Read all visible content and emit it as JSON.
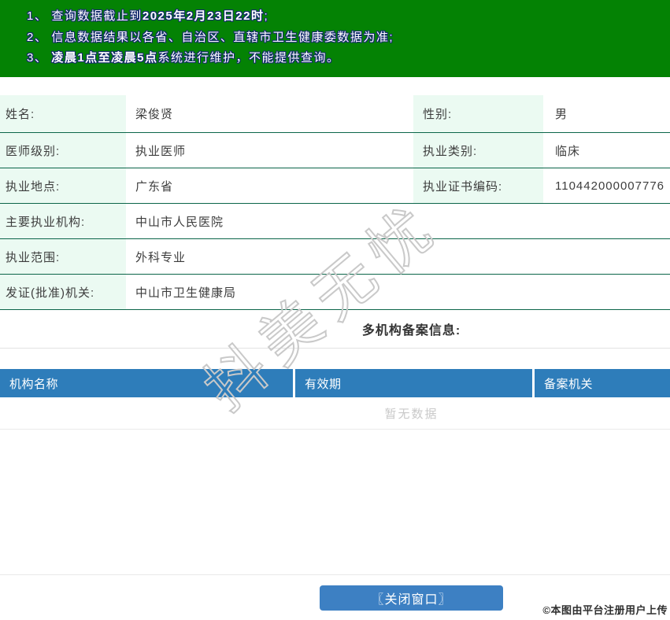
{
  "banner": {
    "notices": [
      {
        "num": "1、",
        "pre": "查询数据截止到",
        "bold": "2025年2月23日22时",
        "post": ";"
      },
      {
        "num": "2、",
        "pre": "信息数据结果以各省、自治区、直辖市卫生健康委数据为准;",
        "bold": "",
        "post": ""
      },
      {
        "num": "3、",
        "pre": "",
        "bold": "凌晨1点至凌晨5点",
        "post": "系统进行维护，不能提供查询。"
      }
    ]
  },
  "info": {
    "rows2col": [
      {
        "label1": "姓名:",
        "value1": "梁俊贤",
        "label2": "性别:",
        "value2": "男"
      },
      {
        "label1": "医师级别:",
        "value1": "执业医师",
        "label2": "执业类别:",
        "value2": "临床"
      },
      {
        "label1": "执业地点:",
        "value1": "广东省",
        "label2": "执业证书编码:",
        "value2": "110442000007776"
      }
    ],
    "rows1col": [
      {
        "label": "主要执业机构:",
        "value": "中山市人民医院"
      },
      {
        "label": "执业范围:",
        "value": "外科专业"
      },
      {
        "label": "发证(批准)机关:",
        "value": "中山市卫生健康局"
      }
    ]
  },
  "filing": {
    "title": "多机构备案信息:",
    "columns": [
      "机构名称",
      "有效期",
      "备案机关"
    ],
    "empty_text": "暂无数据"
  },
  "watermark_text": "抖美无忧",
  "footer": {
    "close_button": "〖关闭窗口〗",
    "copyright": "©本图由平台注册用户上传"
  },
  "colors": {
    "banner_green": "#048204",
    "banner_text_outline": "#142a6e",
    "label_cell_mint": "#ebfaf2",
    "row_line_green": "#0b6549",
    "table_header_blue": "#2e7dba",
    "button_blue": "#3d80c3",
    "empty_text_gray": "#c9c9c9"
  }
}
